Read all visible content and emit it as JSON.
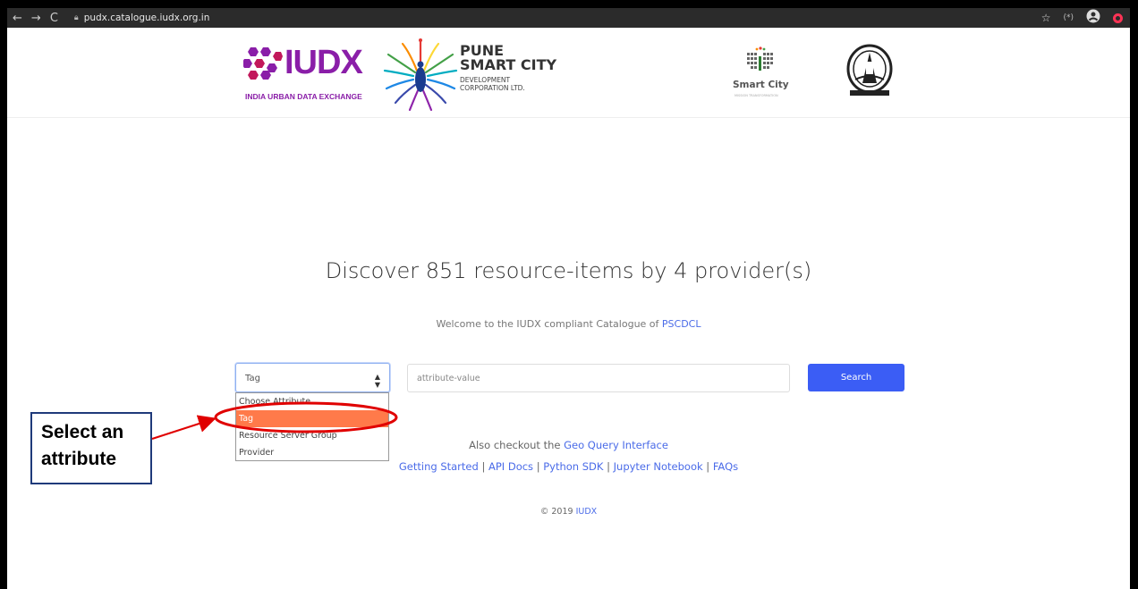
{
  "browser": {
    "back": "←",
    "forward": "→",
    "reload": "C",
    "url": "pudx.catalogue.iudx.org.in",
    "star": "☆",
    "ext": "(*)",
    "account": "●"
  },
  "logos": {
    "iudx_word": "IUDX",
    "iudx_sub": "INDIA URBAN DATA EXCHANGE",
    "pune_line1": "PUNE",
    "pune_line2": "SMART CITY",
    "pune_line3": "DEVELOPMENT",
    "pune_line4": "CORPORATION LTD.",
    "smart_city": "Smart City",
    "smart_city_tag": "MISSION TRANSFORMATION",
    "iisc_caption": "भारतीय विज्ञान संस्थान"
  },
  "main": {
    "headline": "Discover 851 resource-items by 4 provider(s)",
    "welcome_prefix": "Welcome to the IUDX compliant Catalogue of ",
    "welcome_link": "PSCDCL"
  },
  "search": {
    "selected": "Tag",
    "options": [
      "Choose Attribute",
      "Tag",
      "Resource Server Group",
      "Provider"
    ],
    "value_placeholder": "attribute-value",
    "button": "Search"
  },
  "links": {
    "also_prefix": "Also checkout the ",
    "geo_query": "Geo Query Interface",
    "getting_started": "Getting Started",
    "api_docs": "API Docs",
    "python_sdk": "Python SDK",
    "jupyter": "Jupyter Notebook",
    "faqs": "FAQs",
    "sep": " | "
  },
  "footer": {
    "copyright": "© 2019 ",
    "link": "IUDX"
  },
  "annotation": {
    "line1": "Select an",
    "line2": "attribute",
    "color": "#e00000"
  }
}
